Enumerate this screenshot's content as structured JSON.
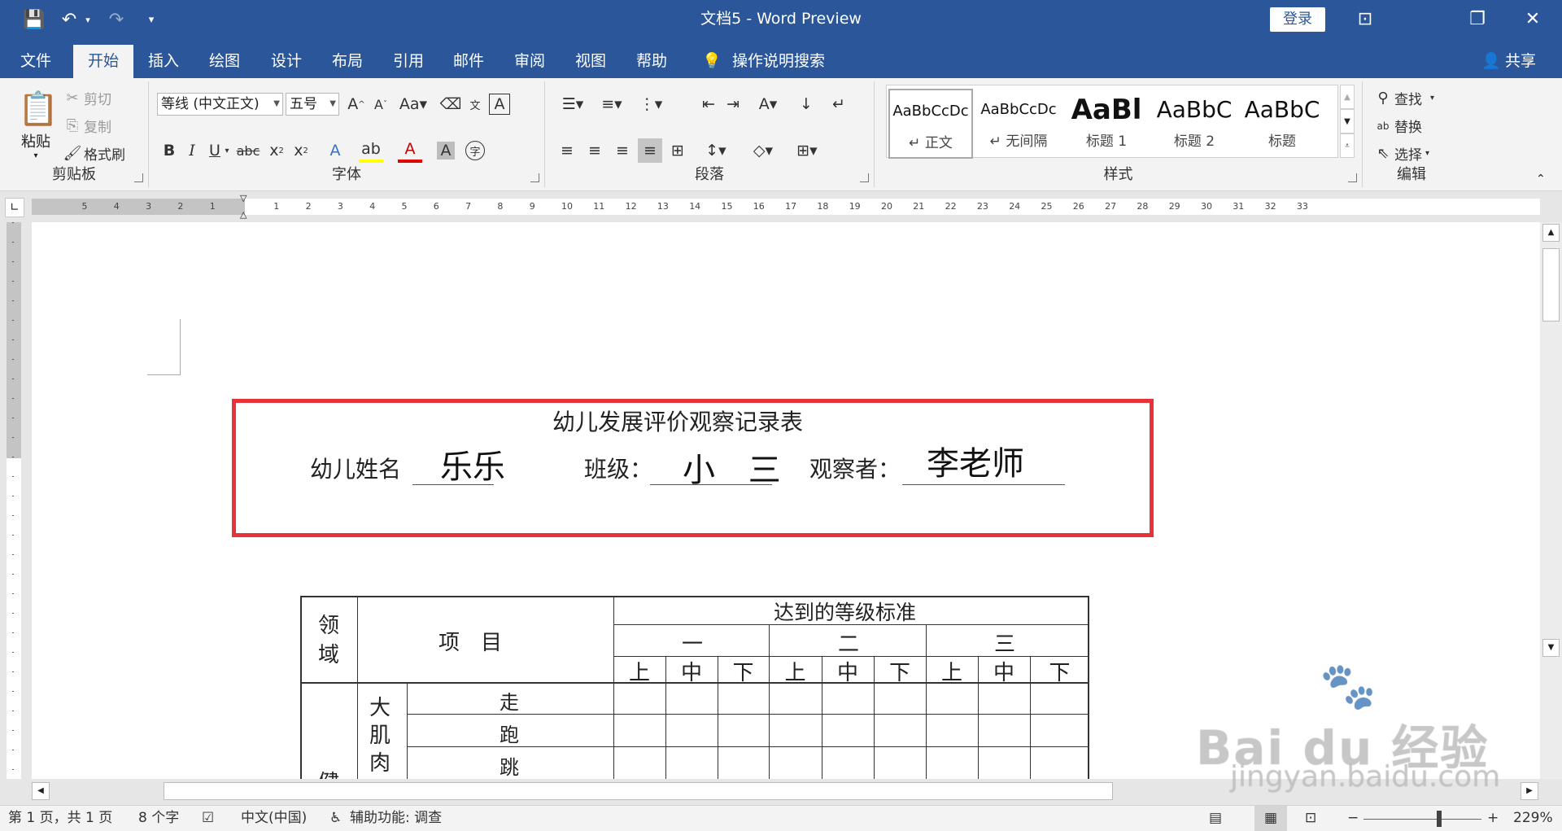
{
  "app": {
    "doc_name": "文档5",
    "separator": " - ",
    "app_name": "Word Preview"
  },
  "quick_access": {
    "save": "💾",
    "undo": "↶",
    "redo": "↷",
    "customize": "▾"
  },
  "titlebar": {
    "login_label": "登录",
    "share_label": "共享",
    "window_buttons": [
      "⊡",
      "❐",
      "✕"
    ]
  },
  "tabs": [
    "文件",
    "开始",
    "插入",
    "绘图",
    "设计",
    "布局",
    "引用",
    "邮件",
    "审阅",
    "视图",
    "帮助"
  ],
  "active_tab": "开始",
  "tell_me": "操作说明搜索",
  "ribbon": {
    "clipboard": {
      "label": "剪贴板",
      "paste": "粘贴",
      "cut": "剪切",
      "copy": "复制",
      "format_painter": "格式刷"
    },
    "font": {
      "label": "字体",
      "font_name": "等线 (中文正文)",
      "font_size": "五号"
    },
    "paragraph": {
      "label": "段落"
    },
    "styles": {
      "label": "样式",
      "items": [
        {
          "sample": "AaBbCcDc",
          "name": "↵ 正文"
        },
        {
          "sample": "AaBbCcDc",
          "name": "↵ 无间隔"
        },
        {
          "sample": "AaBl",
          "name": "标题 1"
        },
        {
          "sample": "AaBbC",
          "name": "标题 2"
        },
        {
          "sample": "AaBbC",
          "name": "标题"
        }
      ]
    },
    "editing": {
      "label": "编辑",
      "find": "查找",
      "replace": "替换",
      "select": "选择"
    }
  },
  "ruler": {
    "left_marks": [
      "5",
      "4",
      "3",
      "2",
      "1"
    ],
    "right_marks": [
      "1",
      "2",
      "3",
      "4",
      "5",
      "6",
      "7",
      "8",
      "9",
      "10",
      "11",
      "12",
      "13",
      "14",
      "15",
      "16",
      "17",
      "18",
      "19",
      "20",
      "21",
      "22",
      "23",
      "24",
      "25",
      "26",
      "27",
      "28",
      "29",
      "30",
      "31",
      "32",
      "33"
    ]
  },
  "document": {
    "title": "幼儿发展评价观察记录表",
    "name_label": "幼儿姓名",
    "name_value": "乐乐",
    "class_label": "班级：",
    "class_value": "小 三",
    "observer_label": "观察者：",
    "observer_value": "李老师",
    "table": {
      "domain_header": "领域",
      "item_header": "项　目",
      "level_header": "达到的等级标准",
      "levels": [
        "一",
        "二",
        "三"
      ],
      "grades": [
        "上",
        "中",
        "下",
        "上",
        "中",
        "下",
        "上",
        "中",
        "下"
      ],
      "big_muscle": "大肌肉",
      "rows": [
        "走",
        "跑",
        "跳"
      ],
      "partial_domain": "健"
    }
  },
  "status": {
    "page": "第 1 页，共 1 页",
    "words": "8 个字",
    "language": "中文(中国)",
    "accessibility": "辅助功能: 调查",
    "zoom": "229%"
  },
  "watermark": {
    "brand": "Bai du 经验",
    "url": "jingyan.baidu.com"
  },
  "colors": {
    "brand_blue": "#2b579a",
    "highlight_box": "#e8323a"
  }
}
